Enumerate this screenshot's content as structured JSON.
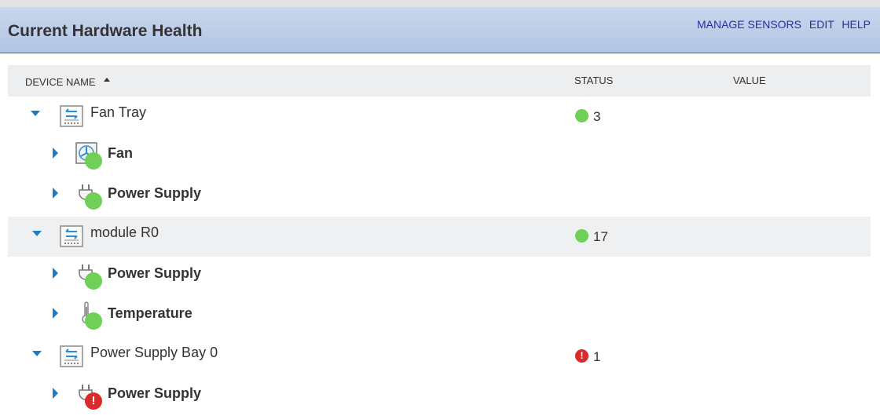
{
  "header": {
    "title": "Current Hardware Health",
    "links": [
      "MANAGE SENSORS",
      "EDIT",
      "HELP"
    ]
  },
  "columns": {
    "device_name": "DEVICE NAME",
    "status": "STATUS",
    "value": "VALUE",
    "sort": "ascending"
  },
  "tree": [
    {
      "name": "Fan Tray",
      "icon": "hardware-module-icon",
      "status": "ok",
      "count": "3",
      "children": [
        {
          "name": "Fan",
          "icon": "fan-icon",
          "status": "ok"
        },
        {
          "name": "Power Supply",
          "icon": "power-plug-icon",
          "status": "ok"
        }
      ]
    },
    {
      "name": "module R0",
      "icon": "hardware-module-icon",
      "status": "ok",
      "count": "17",
      "children": [
        {
          "name": "Power Supply",
          "icon": "power-plug-icon",
          "status": "ok"
        },
        {
          "name": "Temperature",
          "icon": "thermometer-icon",
          "status": "ok"
        }
      ]
    },
    {
      "name": "Power Supply Bay 0",
      "icon": "hardware-module-icon",
      "status": "error",
      "count": "1",
      "children": [
        {
          "name": "Power Supply",
          "icon": "power-plug-icon",
          "status": "error"
        }
      ]
    }
  ],
  "status_symbols": {
    "error": "!"
  },
  "colors": {
    "ok": "#6fcf56",
    "error": "#d92b2b",
    "link": "#2b2e9e",
    "caret": "#1f7cc1",
    "header": "#b3c6e6"
  }
}
